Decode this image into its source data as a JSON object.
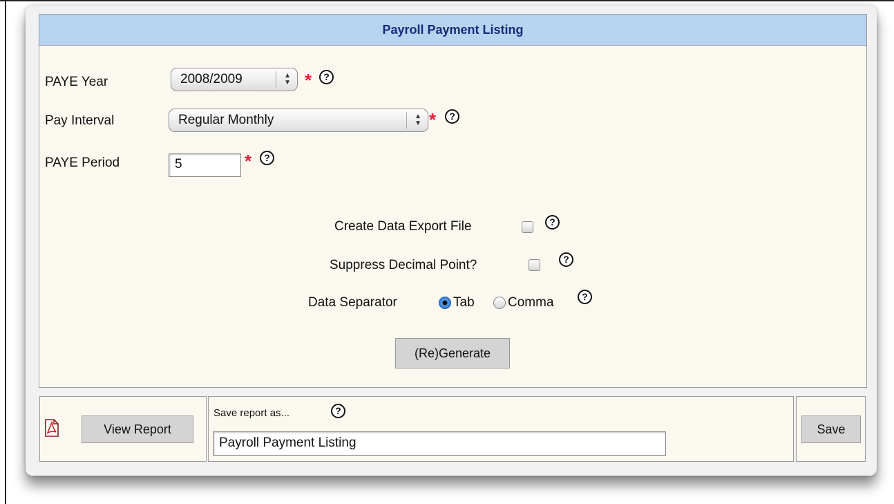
{
  "form": {
    "title": "Payroll Payment Listing",
    "paye_year": {
      "label": "PAYE Year",
      "value": "2008/2009"
    },
    "pay_interval": {
      "label": "Pay Interval",
      "value": "Regular Monthly"
    },
    "paye_period": {
      "label": "PAYE Period",
      "value": "5"
    },
    "required_marker": "*",
    "help_glyph": "?",
    "create_export": {
      "label": "Create Data Export File",
      "checked": false
    },
    "suppress_decimal": {
      "label": "Suppress Decimal Point?",
      "checked": false
    },
    "data_separator": {
      "label": "Data Separator",
      "options": [
        "Tab",
        "Comma"
      ],
      "selected": "Tab"
    },
    "generate_button": "(Re)Generate"
  },
  "footer": {
    "view_report_button": "View Report",
    "save_label": "Save report as...",
    "save_name_value": "Payroll Payment Listing",
    "save_button": "Save",
    "pdf_icon": "pdf-file-icon"
  },
  "colors": {
    "title_bar_bg": "#b8d3f0",
    "title_text": "#142d7a",
    "panel_bg": "#fbf8ef",
    "required_star": "#e0203a"
  }
}
